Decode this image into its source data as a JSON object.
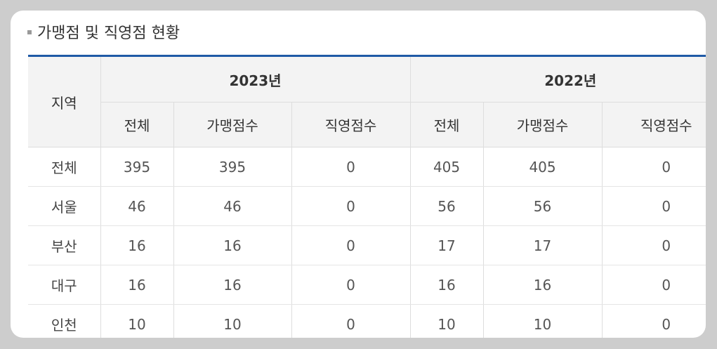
{
  "title": "가맹점 및 직영점 현황",
  "columns": {
    "region_header": "지역",
    "years": [
      "2023년",
      "2022년"
    ],
    "sub_headers": [
      "전체",
      "가맹점수",
      "직영점수"
    ]
  },
  "rows": [
    {
      "region": "전체",
      "y2023": [
        "395",
        "395",
        "0"
      ],
      "y2022": [
        "405",
        "405",
        "0"
      ]
    },
    {
      "region": "서울",
      "y2023": [
        "46",
        "46",
        "0"
      ],
      "y2022": [
        "56",
        "56",
        "0"
      ]
    },
    {
      "region": "부산",
      "y2023": [
        "16",
        "16",
        "0"
      ],
      "y2022": [
        "17",
        "17",
        "0"
      ]
    },
    {
      "region": "대구",
      "y2023": [
        "16",
        "16",
        "0"
      ],
      "y2022": [
        "16",
        "16",
        "0"
      ]
    },
    {
      "region": "인천",
      "y2023": [
        "10",
        "10",
        "0"
      ],
      "y2022": [
        "10",
        "10",
        "0"
      ]
    }
  ],
  "colors": {
    "accent_line": "#1f5aa6",
    "header_bg": "#f3f3f3",
    "page_bg": "#cdcdcd"
  }
}
